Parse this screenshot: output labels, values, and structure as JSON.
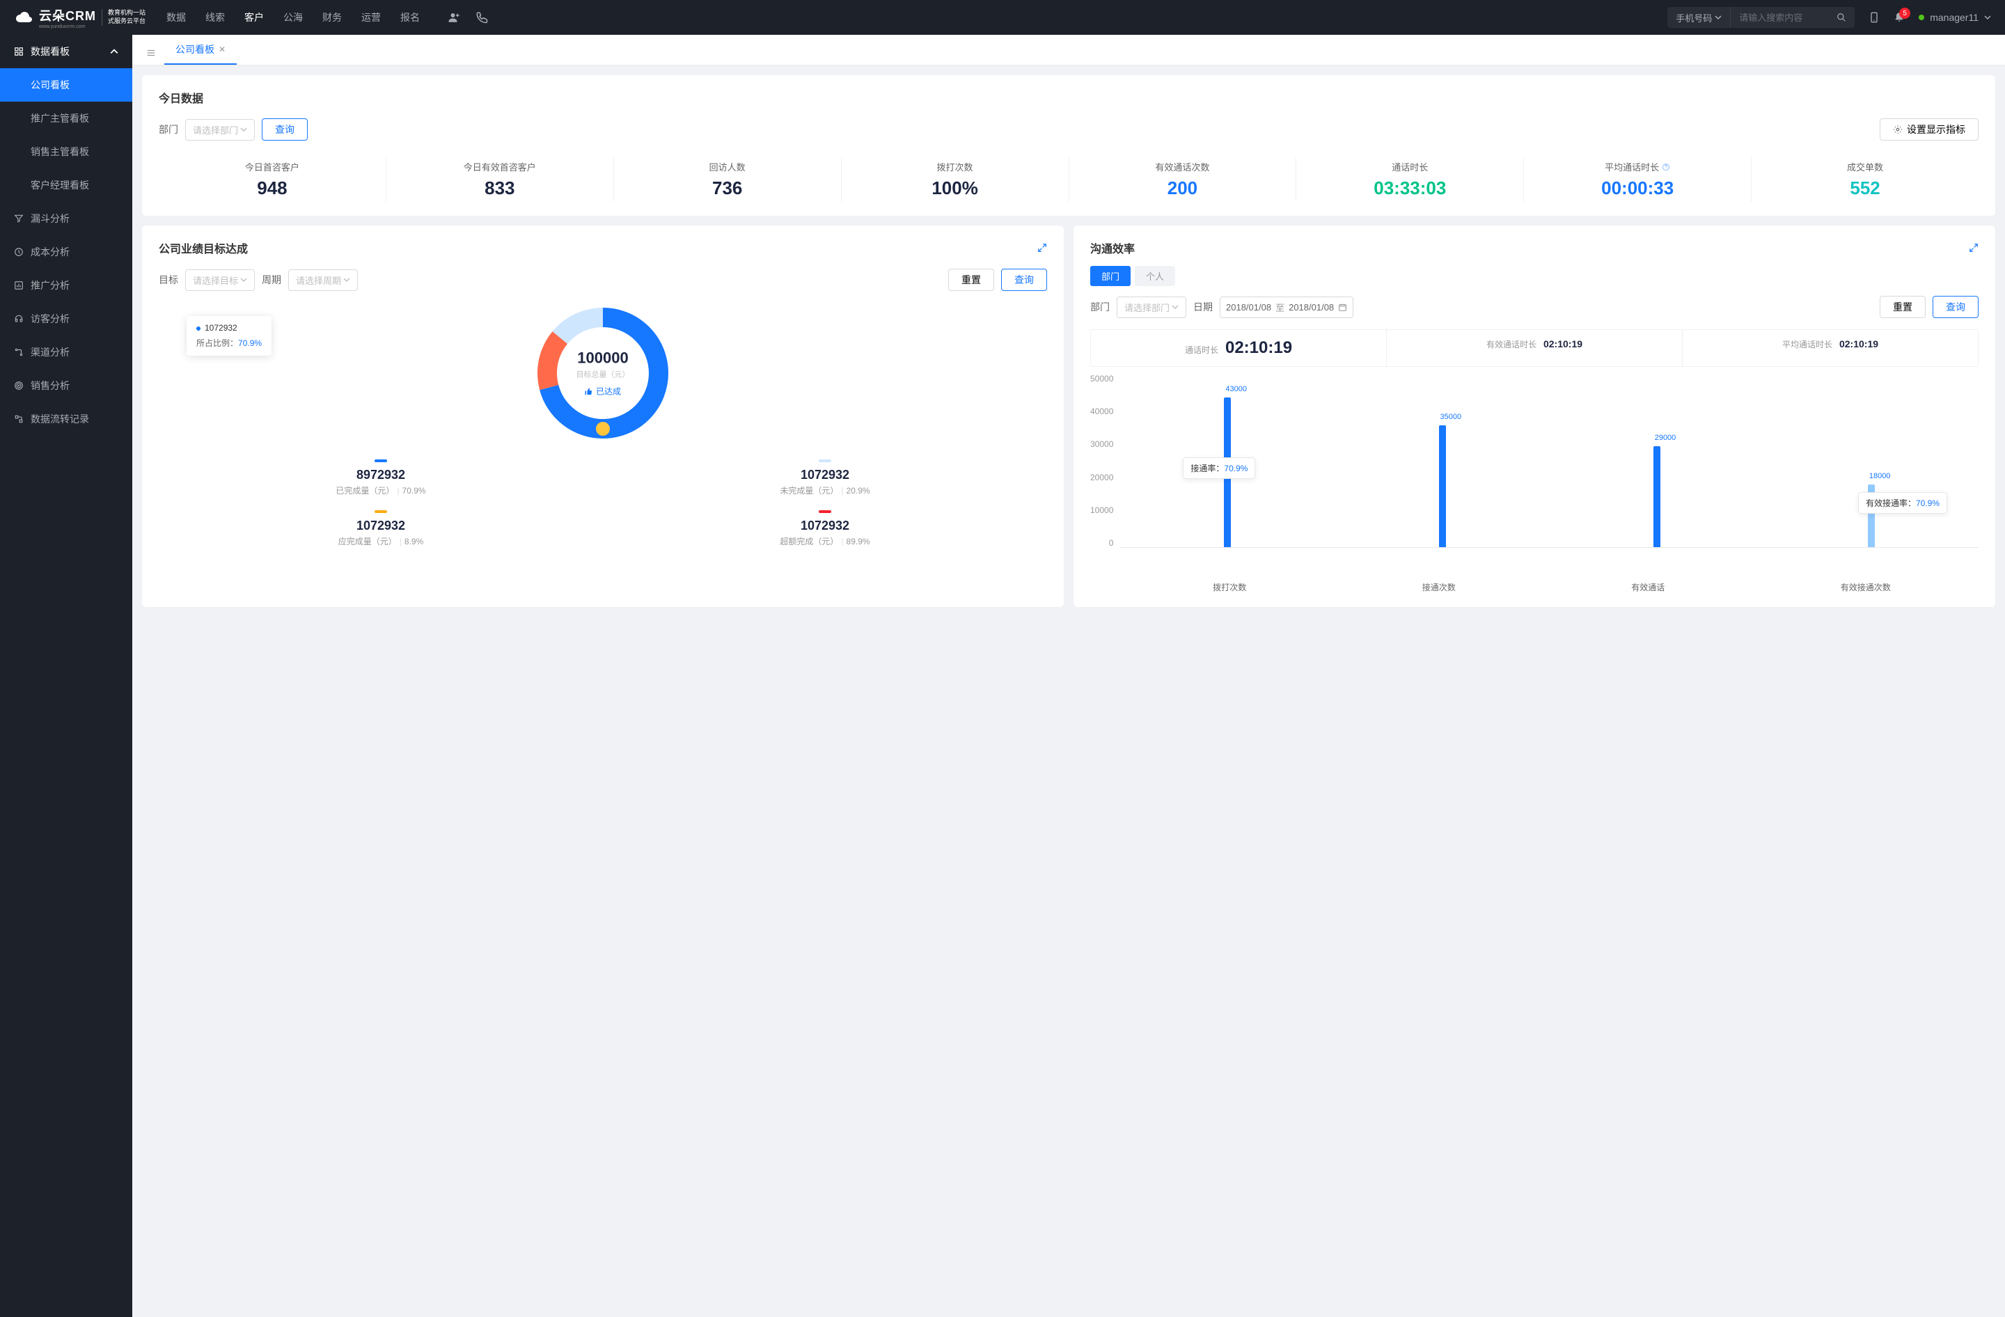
{
  "header": {
    "logo_main": "云朵CRM",
    "logo_sub_url": "www.yunduocrm.com",
    "logo_sub1": "教育机构一站",
    "logo_sub2": "式服务云平台",
    "nav": [
      "数据",
      "线索",
      "客户",
      "公海",
      "财务",
      "运营",
      "报名"
    ],
    "nav_active": 2,
    "search_type": "手机号码",
    "search_placeholder": "请输入搜索内容",
    "badge_count": "5",
    "username": "manager11"
  },
  "sidebar": {
    "group_title": "数据看板",
    "items": [
      "公司看板",
      "推广主管看板",
      "销售主管看板",
      "客户经理看板"
    ],
    "active": 0,
    "flat": [
      {
        "label": "漏斗分析",
        "icon": "funnel-icon"
      },
      {
        "label": "成本分析",
        "icon": "clock-icon"
      },
      {
        "label": "推广分析",
        "icon": "chart-icon"
      },
      {
        "label": "访客分析",
        "icon": "headset-icon"
      },
      {
        "label": "渠道分析",
        "icon": "route-icon"
      },
      {
        "label": "销售分析",
        "icon": "target-icon"
      },
      {
        "label": "数据流转记录",
        "icon": "flow-icon"
      }
    ]
  },
  "tabs": {
    "current": "公司看板"
  },
  "today": {
    "title": "今日数据",
    "dept_label": "部门",
    "dept_placeholder": "请选择部门",
    "query_btn": "查询",
    "settings_btn": "设置显示指标",
    "metrics": [
      {
        "label": "今日首咨客户",
        "value": "948",
        "cls": "c-dark"
      },
      {
        "label": "今日有效首咨客户",
        "value": "833",
        "cls": "c-dark"
      },
      {
        "label": "回访人数",
        "value": "736",
        "cls": "c-dark"
      },
      {
        "label": "拨打次数",
        "value": "100%",
        "cls": "c-dark"
      },
      {
        "label": "有效通话次数",
        "value": "200",
        "cls": "c-blue"
      },
      {
        "label": "通话时长",
        "value": "03:33:03",
        "cls": "c-green"
      },
      {
        "label": "平均通话时长",
        "value": "00:00:33",
        "cls": "c-blue",
        "help": true
      },
      {
        "label": "成交单数",
        "value": "552",
        "cls": "c-cyan"
      }
    ]
  },
  "goal": {
    "title": "公司业绩目标达成",
    "target_label": "目标",
    "target_placeholder": "请选择目标",
    "period_label": "周期",
    "period_placeholder": "请选择周期",
    "reset_btn": "重置",
    "query_btn": "查询",
    "center_value": "100000",
    "center_label": "目标总量（元）",
    "achieved_label": "已达成",
    "tooltip_value": "1072932",
    "tooltip_ratio_label": "所占比例：",
    "tooltip_ratio": "70.9%",
    "legend": [
      {
        "color": "#1677ff",
        "value": "8972932",
        "label": "已完成量（元）",
        "pct": "70.9%"
      },
      {
        "color": "#cfe6ff",
        "value": "1072932",
        "label": "未完成量（元）",
        "pct": "20.9%"
      },
      {
        "color": "#faad14",
        "value": "1072932",
        "label": "应完成量（元）",
        "pct": "8.9%"
      },
      {
        "color": "#f5222d",
        "value": "1072932",
        "label": "超额完成（元）",
        "pct": "89.9%"
      }
    ]
  },
  "eff": {
    "title": "沟通效率",
    "tab_dept": "部门",
    "tab_person": "个人",
    "dept_label": "部门",
    "dept_placeholder": "请选择部门",
    "date_label": "日期",
    "date_from": "2018/01/08",
    "date_to": "2018/01/08",
    "date_sep": "至",
    "reset_btn": "重置",
    "query_btn": "查询",
    "stats": [
      {
        "label": "通话时长",
        "value": "02:10:19"
      },
      {
        "label": "有效通话时长",
        "value": "02:10:19"
      },
      {
        "label": "平均通话时长",
        "value": "02:10:19"
      }
    ],
    "anno1_label": "接通率：",
    "anno1_pct": "70.9%",
    "anno2_label": "有效接通率：",
    "anno2_pct": "70.9%"
  },
  "chart_data": {
    "type": "bar",
    "categories": [
      "拨打次数",
      "接通次数",
      "有效通话",
      "有效接通次数"
    ],
    "values": [
      43000,
      35000,
      29000,
      18000
    ],
    "labels": [
      "43000",
      "35000",
      "29000",
      "18000"
    ],
    "ylim": [
      0,
      50000
    ],
    "yticks": [
      "50000",
      "40000",
      "30000",
      "20000",
      "10000",
      "0"
    ]
  }
}
